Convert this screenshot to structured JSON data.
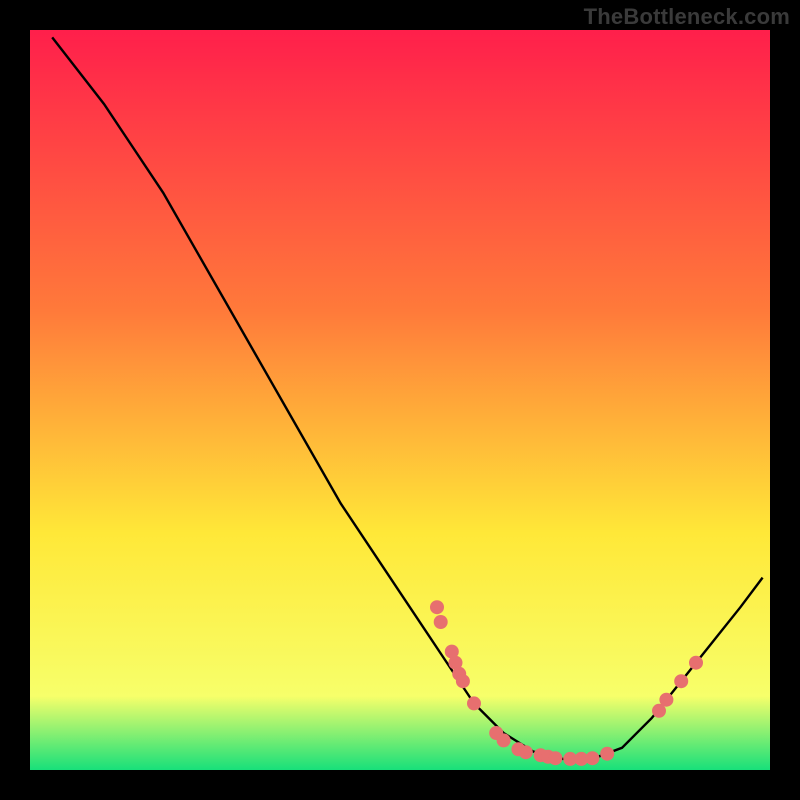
{
  "watermark": "TheBottleneck.com",
  "colors": {
    "dot": "#e76f6f",
    "curve": "#000000",
    "gradient_top": "#ff1f4b",
    "gradient_mid1": "#ff7a3a",
    "gradient_mid2": "#ffe838",
    "gradient_bottom1": "#f7ff6a",
    "gradient_bottom2": "#17e07a"
  },
  "chart_data": {
    "type": "line",
    "title": "",
    "xlabel": "",
    "ylabel": "",
    "xlim": [
      0,
      100
    ],
    "ylim": [
      0,
      100
    ],
    "curve": [
      {
        "x": 3,
        "y": 99
      },
      {
        "x": 10,
        "y": 90
      },
      {
        "x": 18,
        "y": 78
      },
      {
        "x": 26,
        "y": 64
      },
      {
        "x": 34,
        "y": 50
      },
      {
        "x": 42,
        "y": 36
      },
      {
        "x": 50,
        "y": 24
      },
      {
        "x": 56,
        "y": 15
      },
      {
        "x": 60,
        "y": 9
      },
      {
        "x": 64,
        "y": 5
      },
      {
        "x": 68,
        "y": 2.5
      },
      {
        "x": 72,
        "y": 1.5
      },
      {
        "x": 76,
        "y": 1.5
      },
      {
        "x": 80,
        "y": 3
      },
      {
        "x": 84,
        "y": 7
      },
      {
        "x": 88,
        "y": 12
      },
      {
        "x": 92,
        "y": 17
      },
      {
        "x": 96,
        "y": 22
      },
      {
        "x": 99,
        "y": 26
      }
    ],
    "dots": [
      {
        "x": 55,
        "y": 22
      },
      {
        "x": 55.5,
        "y": 20
      },
      {
        "x": 57,
        "y": 16
      },
      {
        "x": 57.5,
        "y": 14.5
      },
      {
        "x": 58,
        "y": 13
      },
      {
        "x": 58.5,
        "y": 12
      },
      {
        "x": 60,
        "y": 9
      },
      {
        "x": 63,
        "y": 5
      },
      {
        "x": 64,
        "y": 4
      },
      {
        "x": 66,
        "y": 2.8
      },
      {
        "x": 67,
        "y": 2.4
      },
      {
        "x": 69,
        "y": 2
      },
      {
        "x": 70,
        "y": 1.8
      },
      {
        "x": 71,
        "y": 1.6
      },
      {
        "x": 73,
        "y": 1.5
      },
      {
        "x": 74.5,
        "y": 1.5
      },
      {
        "x": 76,
        "y": 1.6
      },
      {
        "x": 78,
        "y": 2.2
      },
      {
        "x": 85,
        "y": 8
      },
      {
        "x": 86,
        "y": 9.5
      },
      {
        "x": 88,
        "y": 12
      },
      {
        "x": 90,
        "y": 14.5
      }
    ]
  }
}
